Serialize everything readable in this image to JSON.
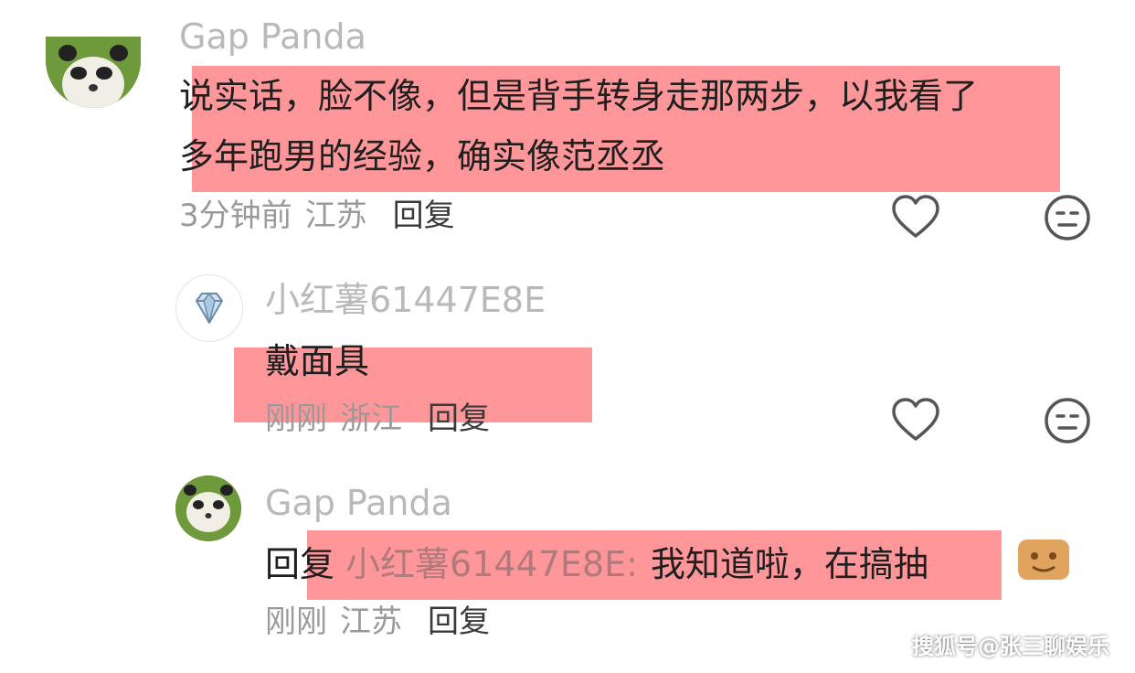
{
  "comments": [
    {
      "user": "Gap Panda",
      "text_line1": "说实话，脸不像，但是背手转身走那两步，以我看了",
      "text_line2": "多年跑男的经验，确实像范丞丞",
      "time": "3分钟前",
      "location": "江苏",
      "reply_label": "回复"
    },
    {
      "user": "小红薯61447E8E",
      "text": "戴面具",
      "time": "刚刚",
      "location": "浙江",
      "reply_label": "回复"
    },
    {
      "user": "Gap Panda",
      "reply_prefix": "回复",
      "reply_to": "小红薯61447E8E",
      "reply_sep": ":",
      "text": "我知道啦，在搞抽",
      "time": "刚刚",
      "location": "江苏",
      "reply_label": "回复"
    }
  ],
  "watermark": "搜狐号@张三聊娱乐",
  "icons": [
    "heart-outline-icon",
    "neutral-face-icon",
    "diamond-icon",
    "panda-avatar"
  ],
  "colors": {
    "highlight": "#ff6e73",
    "username": "#b9b9b9",
    "meta": "#9a9a9a",
    "text": "#1f1f1f"
  }
}
